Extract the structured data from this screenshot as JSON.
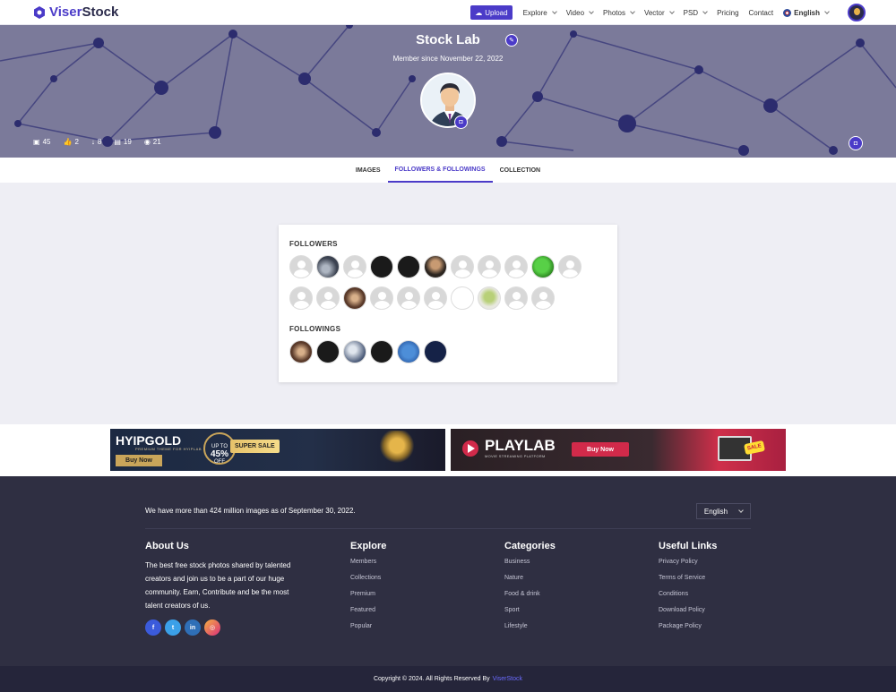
{
  "nav": {
    "logo_text_1": "Viser",
    "logo_text_2": "Stock",
    "upload_label": "Upload",
    "items": [
      {
        "label": "Explore",
        "dropdown": true
      },
      {
        "label": "Video",
        "dropdown": true
      },
      {
        "label": "Photos",
        "dropdown": true
      },
      {
        "label": "Vector",
        "dropdown": true
      },
      {
        "label": "PSD",
        "dropdown": true
      },
      {
        "label": "Pricing",
        "dropdown": false
      },
      {
        "label": "Contact",
        "dropdown": false
      }
    ],
    "language": "English"
  },
  "profile": {
    "name": "Stock Lab",
    "member_since": "Member since November 22, 2022",
    "stats": [
      {
        "icon": "image-icon",
        "value": "45"
      },
      {
        "icon": "thumbs-up-icon",
        "value": "2"
      },
      {
        "icon": "download-icon",
        "value": "8"
      },
      {
        "icon": "collection-icon",
        "value": "19"
      },
      {
        "icon": "eye-icon",
        "value": "21"
      }
    ]
  },
  "tabs": [
    {
      "label": "IMAGES",
      "active": false
    },
    {
      "label": "FOLLOWERS & FOLLOWINGS",
      "active": true
    },
    {
      "label": "COLLECTION",
      "active": false
    }
  ],
  "followers": {
    "title": "FOLLOWERS",
    "row1": [
      "ph",
      "photo1",
      "ph",
      "dark",
      "dark",
      "photo2",
      "ph",
      "ph",
      "ph",
      "green",
      "ph"
    ],
    "row2": [
      "ph",
      "ph",
      "photo3",
      "ph",
      "ph",
      "ph",
      "white",
      "green2",
      "ph",
      "ph"
    ]
  },
  "followings": {
    "title": "FOLLOWINGS",
    "items": [
      "photo3",
      "dark",
      "silver",
      "dark",
      "blue",
      "navy"
    ]
  },
  "ads": {
    "ad1": {
      "logo": "HYIPGOLD",
      "sub": "PREMIUM THEME FOR HYIPLAB",
      "buy": "Buy Now",
      "disc_top": "UP TO",
      "disc_value": "45%",
      "disc_bottom": "OFF",
      "super": "SUPER SALE"
    },
    "ad2": {
      "logo": "PLAYLAB",
      "sub": "MOVIE STREAMING PLATFORM",
      "buy": "Buy Now",
      "sale": "SALE"
    }
  },
  "footer": {
    "headline": "We have more than 424 million images as of September 30, 2022.",
    "language": "English",
    "about": {
      "title": "About Us",
      "text": "The best free stock photos shared by talented creators and join us to be a part of our huge community. Earn, Contribute and be the most talent creators of us."
    },
    "explore": {
      "title": "Explore",
      "links": [
        "Members",
        "Collections",
        "Premium",
        "Featured",
        "Popular"
      ]
    },
    "categories": {
      "title": "Categories",
      "links": [
        "Business",
        "Nature",
        "Food & drink",
        "Sport",
        "Lifestyle"
      ]
    },
    "useful": {
      "title": "Useful Links",
      "links": [
        "Privacy Policy",
        "Terms of Service",
        "Conditions",
        "Download Policy",
        "Package Policy"
      ]
    },
    "copyright": "Copyright © 2024. All Rights Reserved By",
    "copyright_brand": "ViserStock"
  },
  "colors": {
    "accent": "#4b3bc8",
    "footer_bg": "#2f2f42",
    "hero_bg": "#7b7a9a"
  }
}
